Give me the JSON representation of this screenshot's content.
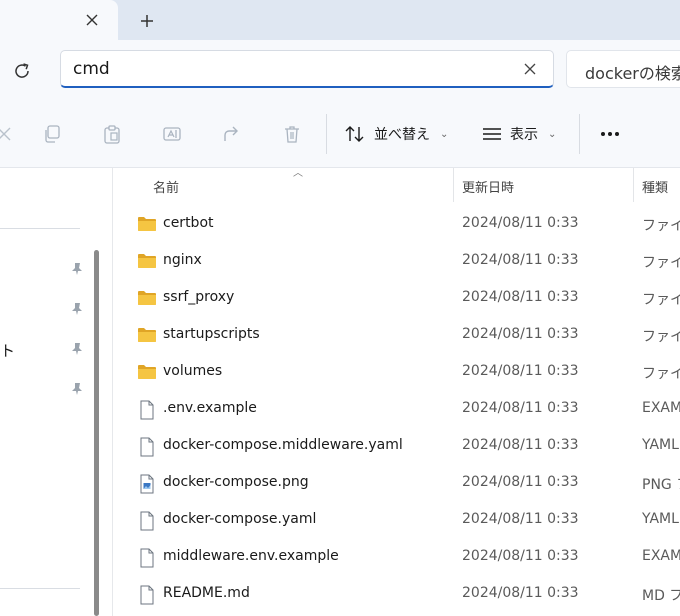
{
  "tab": {
    "close_glyph": "✕",
    "new_tab_glyph": "+"
  },
  "address": {
    "value": "cmd"
  },
  "search": {
    "placeholder": "dockerの検索"
  },
  "toolbar": {
    "sort_label": "並べ替え",
    "view_label": "表示"
  },
  "nav": {
    "partial_text": "ト"
  },
  "columns": {
    "name": "名前",
    "modified": "更新日時",
    "type": "種類"
  },
  "files": [
    {
      "name": "certbot",
      "modified": "2024/08/11 0:33",
      "type": "ファイル",
      "icon": "folder-icon"
    },
    {
      "name": "nginx",
      "modified": "2024/08/11 0:33",
      "type": "ファイル",
      "icon": "folder-icon"
    },
    {
      "name": "ssrf_proxy",
      "modified": "2024/08/11 0:33",
      "type": "ファイル",
      "icon": "folder-icon"
    },
    {
      "name": "startupscripts",
      "modified": "2024/08/11 0:33",
      "type": "ファイル",
      "icon": "folder-icon"
    },
    {
      "name": "volumes",
      "modified": "2024/08/11 0:33",
      "type": "ファイル",
      "icon": "folder-icon"
    },
    {
      "name": ".env.example",
      "modified": "2024/08/11 0:33",
      "type": "EXAM",
      "icon": "file-icon"
    },
    {
      "name": "docker-compose.middleware.yaml",
      "modified": "2024/08/11 0:33",
      "type": "YAML",
      "icon": "file-icon"
    },
    {
      "name": "docker-compose.png",
      "modified": "2024/08/11 0:33",
      "type": "PNG フ",
      "icon": "image-file-icon"
    },
    {
      "name": "docker-compose.yaml",
      "modified": "2024/08/11 0:33",
      "type": "YAML",
      "icon": "file-icon"
    },
    {
      "name": "middleware.env.example",
      "modified": "2024/08/11 0:33",
      "type": "EXAM",
      "icon": "file-icon"
    },
    {
      "name": "README.md",
      "modified": "2024/08/11 0:33",
      "type": "MD フ",
      "icon": "file-icon"
    }
  ],
  "colors": {
    "accent": "#1f5fbf",
    "folder": "#f5c542",
    "folder_dark": "#e0a526",
    "chrome": "#f7f9fc",
    "tabstrip": "#dfe7f2"
  }
}
